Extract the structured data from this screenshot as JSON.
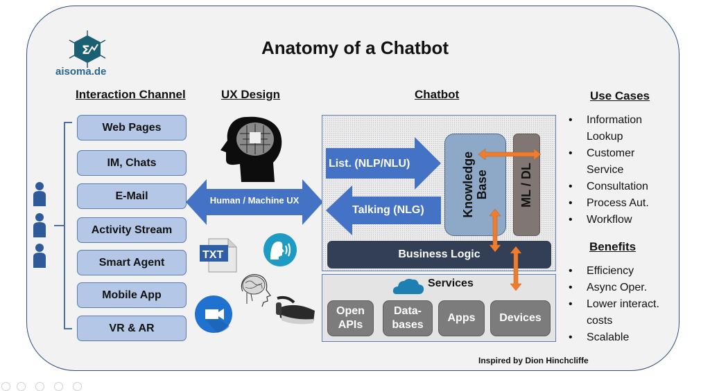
{
  "title": "Anatomy of a Chatbot",
  "logo": {
    "text": "aisoma.de",
    "icon": "sigma-hexagon-logo-icon"
  },
  "colors": {
    "frame_bg": "#f2f2f2",
    "frame_border": "#2f4f7a",
    "channel_fill": "#b4c7e7",
    "arrow_blue": "#4472c4",
    "knowledge_base": "#8ea9c8",
    "ml_dl": "#807674",
    "business_logic": "#323f55",
    "service_fill": "#7c7c7c",
    "orange_arrow": "#ed7d31"
  },
  "sections": {
    "interaction_channel": {
      "heading": "Interaction Channel",
      "items": [
        "Web Pages",
        "IM, Chats",
        "E-Mail",
        "Activity Stream",
        "Smart Agent",
        "Mobile App",
        "VR & AR"
      ],
      "user_icons": [
        "person-icon",
        "person-icon",
        "person-icon"
      ]
    },
    "ux_design": {
      "heading": "UX Design",
      "arrow_label": "Human / Machine UX",
      "icons": [
        "circuit-head-icon",
        "txt-file-icon",
        "voice-speaking-icon",
        "brain-head-icon",
        "video-camera-icon",
        "vr-headset-icon"
      ]
    },
    "chatbot": {
      "heading": "Chatbot",
      "listen_arrow": "List. (NLP/NLU)",
      "talk_arrow": "Talking (NLG)",
      "knowledge_base": "Knowledge Base",
      "ml_dl": "ML / DL",
      "business_logic": "Business Logic",
      "services": {
        "title": "Services",
        "icon": "cloud-icon",
        "items": [
          "Open APIs",
          "Data-bases",
          "Apps",
          "Devices"
        ]
      }
    },
    "use_cases": {
      "heading": "Use Cases",
      "items": [
        "Information Lookup",
        "Customer Service",
        "Consultation",
        "Process Aut.",
        "Workflow"
      ]
    },
    "benefits": {
      "heading": "Benefits",
      "items": [
        "Efficiency",
        "Async Oper.",
        "Lower interact. costs",
        "Scalable"
      ]
    }
  },
  "credit": "Inspired by Dion Hinchcliffe",
  "viewer_controls": [
    "play-icon",
    "edit-icon",
    "copy-icon",
    "zoom-icon",
    "more-icon"
  ]
}
